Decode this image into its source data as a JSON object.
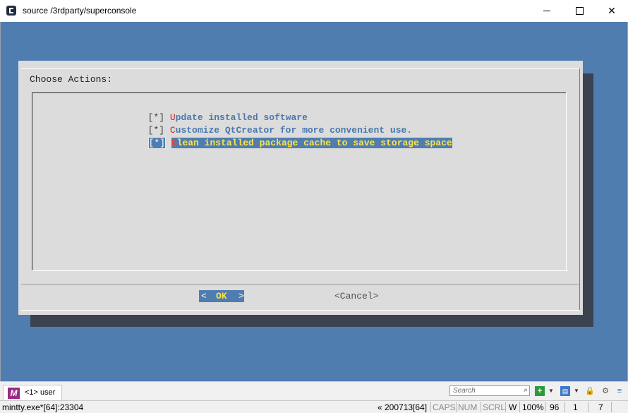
{
  "window": {
    "title": "source /3rdparty/superconsole"
  },
  "dialog": {
    "title": "Choose Actions:",
    "items": [
      {
        "check": "[*]",
        "hotkey": "U",
        "rest": "pdate installed software",
        "selected": false
      },
      {
        "check": "[*]",
        "hotkey": "C",
        "rest": "ustomize QtCreator for more convenient use.",
        "selected": false
      },
      {
        "check": "[*]",
        "hotkey": "C",
        "rest": "lean installed package cache to save storage space",
        "selected": true
      }
    ],
    "ok_left": "<",
    "ok_label": "OK",
    "ok_right": ">",
    "cancel_label": "<Cancel>"
  },
  "tabbar": {
    "tab_label": "<1> user",
    "search_placeholder": "Search"
  },
  "statusbar": {
    "process": "mintty.exe*[64]:23304",
    "build": "« 200713[64]",
    "caps": "CAPS",
    "num": "NUM",
    "scrl": "SCRL",
    "w": "W",
    "zoom": "100%",
    "col": "96",
    "row": "1",
    "count": "7"
  },
  "colors": {
    "terminal_bg": "#4f7db0",
    "dialog_bg": "#dcdcdc",
    "hotkey": "#c0282b",
    "selected_text": "#ffe44a"
  }
}
